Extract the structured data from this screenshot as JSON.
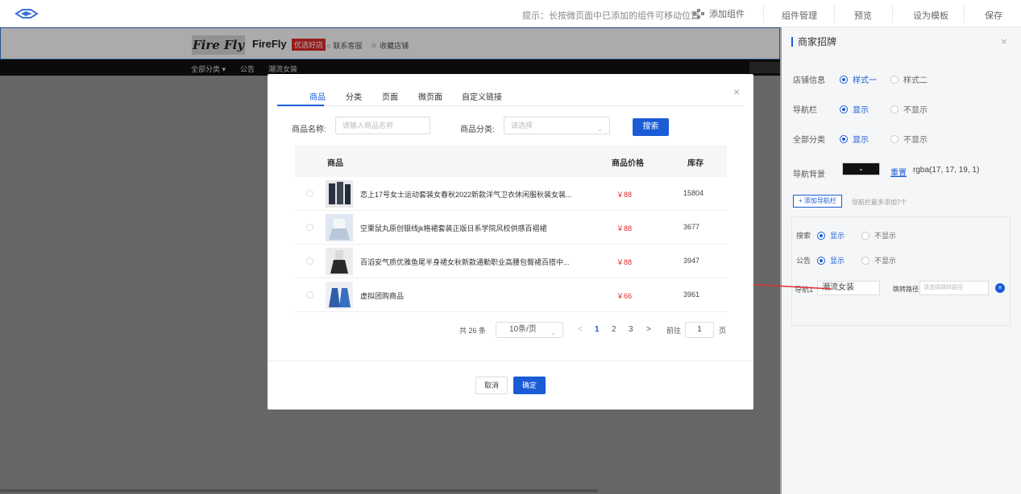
{
  "topbar": {
    "hint": "提示：长按微页面中已添加的组件可移动位置",
    "add_component": "添加组件",
    "component_manage": "组件管理",
    "preview": "预览",
    "set_template": "设为模板",
    "save": "保存"
  },
  "shop": {
    "logo_text": "Fire Fly",
    "name": "FireFly",
    "badge": "优选好店",
    "contact": "联系客服",
    "favorite": "收藏店铺",
    "nav": [
      "全部分类 ▾",
      "公告",
      "潮流女装"
    ]
  },
  "panel": {
    "title": "商家招牌",
    "rows": [
      {
        "label": "店铺信息",
        "opt1": "样式一",
        "opt2": "样式二"
      },
      {
        "label": "导航栏",
        "opt1": "显示",
        "opt2": "不显示"
      },
      {
        "label": "全部分类",
        "opt1": "显示",
        "opt2": "不显示"
      }
    ],
    "nav_bg_label": "导航背景",
    "reset": "重置",
    "rgba": "rgba(17, 17, 19, 1)",
    "add_nav": "+ 添加导航栏",
    "add_nav_tip": "导航栏最多添加7个",
    "search_label": "搜索",
    "notice_label": "公告",
    "show": "显示",
    "hide": "不显示",
    "nav1_label": "导航1",
    "nav1_value": "潮流女装",
    "path_label": "跳转路径",
    "path_placeholder": "请选择跳转路径"
  },
  "dialog": {
    "tabs": [
      "商品",
      "分类",
      "页面",
      "微页面",
      "自定义链接"
    ],
    "name_label": "商品名称:",
    "name_placeholder": "请输入商品名称",
    "category_label": "商品分类:",
    "category_placeholder": "请选择",
    "search_button": "搜索",
    "columns": {
      "product": "商品",
      "price": "商品价格",
      "stock": "库存"
    },
    "rows": [
      {
        "name": "恋上17号女士运动套装女春秋2022新款洋气卫衣休闲服秋装女装...",
        "price": "￥88",
        "stock": "15804"
      },
      {
        "name": "空栗鼠丸原创银线jk格裙套装正版日系学院风校供感百褶裙",
        "price": "￥88",
        "stock": "3677"
      },
      {
        "name": "百滔安气质优雅鱼尾半身裙女秋新款通勤职业高腰包臀裙百搭中...",
        "price": "￥88",
        "stock": "3947"
      },
      {
        "name": "虚拟团购商品",
        "price": "￥66",
        "stock": "3961"
      }
    ],
    "pager": {
      "total": "共 26 条",
      "page_size": "10条/页",
      "prev": "<",
      "pages": [
        "1",
        "2",
        "3"
      ],
      "next": ">",
      "goto": "前往",
      "goto_value": "1",
      "page_unit": "页"
    },
    "cancel": "取消",
    "ok": "确定"
  },
  "colors": {
    "accent": "#1a5bd6",
    "price": "#e02a2a",
    "arrow": "#e03030"
  }
}
